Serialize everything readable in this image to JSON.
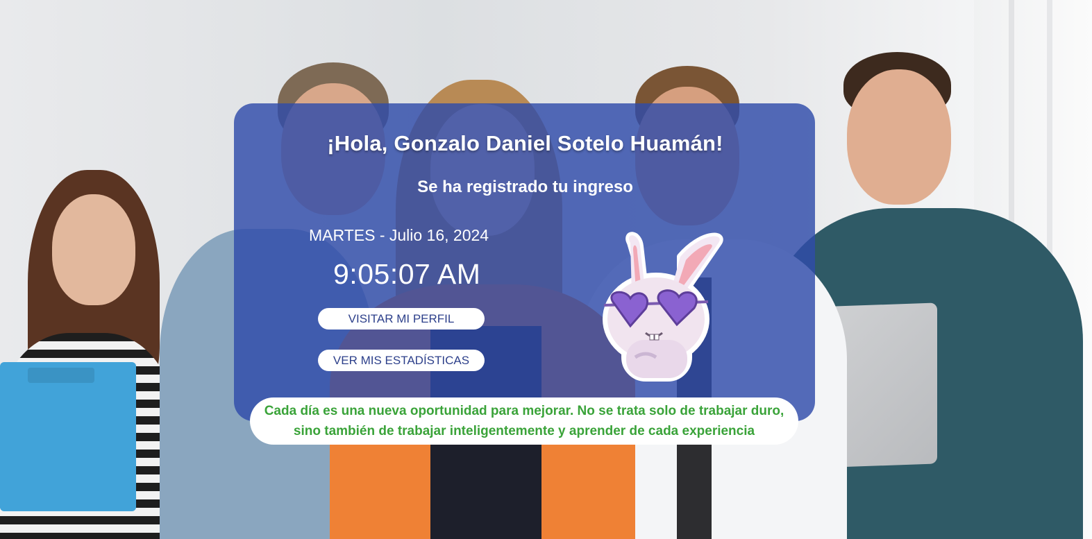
{
  "card": {
    "greeting": "¡Hola, Gonzalo Daniel Sotelo Huamán!",
    "subtitle": "Se ha registrado tu ingreso",
    "date": "MARTES - Julio 16, 2024",
    "time": "9:05:07 AM"
  },
  "actions": {
    "profile_label": "VISITAR MI PERFIL",
    "stats_label": "VER MIS ESTADÍSTICAS"
  },
  "quote": {
    "text": "Cada día es una nueva oportunidad para mejorar. No se trata solo de trabajar duro, sino también de trabajar inteligentemente y aprender de cada experiencia"
  },
  "sticker": {
    "icon": "bunny-sunglasses-icon"
  },
  "colors": {
    "card_bg": "#304caa",
    "button_text": "#2c3f8a",
    "quote_text": "#3aa339"
  }
}
